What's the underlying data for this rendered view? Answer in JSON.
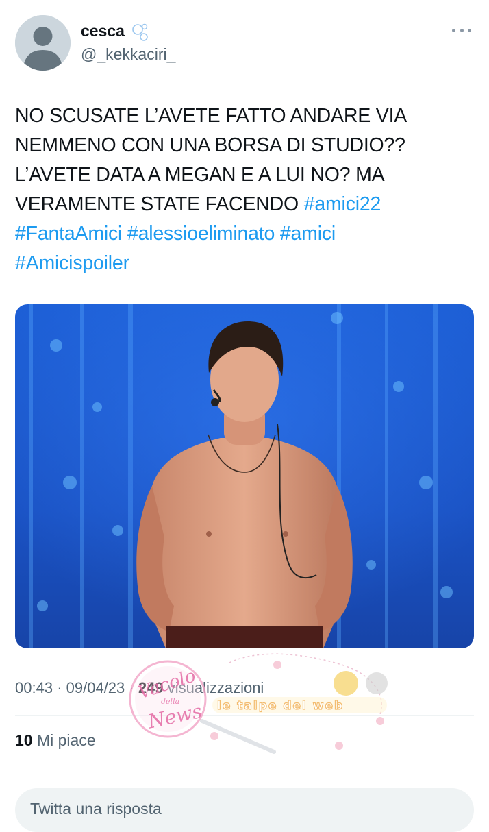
{
  "author": {
    "display_name": "cesca",
    "handle": "@_kekkaciri_"
  },
  "tweet": {
    "lines": [
      [
        {
          "text": "NO SCUSATE L’AVETE FATTO ANDARE VIA",
          "hashtag": false
        }
      ],
      [
        {
          "text": "NEMMENO CON UNA BORSA DI STUDIO??",
          "hashtag": false
        }
      ],
      [
        {
          "text": "L’AVETE DATA A MEGAN E A LUI NO? MA",
          "hashtag": false
        }
      ],
      [
        {
          "text": "VERAMENTE STATE FACENDO ",
          "hashtag": false
        },
        {
          "text": "#amici22",
          "hashtag": true
        }
      ],
      [
        {
          "text": "#FantaAmici",
          "hashtag": true
        },
        {
          "text": " ",
          "hashtag": false
        },
        {
          "text": "#alessioeliminato",
          "hashtag": true
        },
        {
          "text": " ",
          "hashtag": false
        },
        {
          "text": "#amici",
          "hashtag": true
        }
      ],
      [
        {
          "text": "#Amicispoiler",
          "hashtag": true
        }
      ]
    ]
  },
  "meta": {
    "time": "00:43",
    "separator": "·",
    "date": "09/04/23",
    "views_count": "249",
    "views_label": "visualizzazioni"
  },
  "stats": {
    "likes_count": "10",
    "likes_label": "Mi piace"
  },
  "reply": {
    "placeholder": "Twitta una risposta"
  },
  "watermark": {
    "seal_text": "Vacolo della News",
    "banner_text": "le talpe del web"
  },
  "icons": {
    "avatar": "default-avatar-icon",
    "more": "more-options-icon",
    "name_decoration": "bubbles-emoji-icon"
  },
  "colors": {
    "accent": "#1d9bf0",
    "text": "#0f1419",
    "secondary": "#536471",
    "stage_blue": "#1c56c9"
  }
}
